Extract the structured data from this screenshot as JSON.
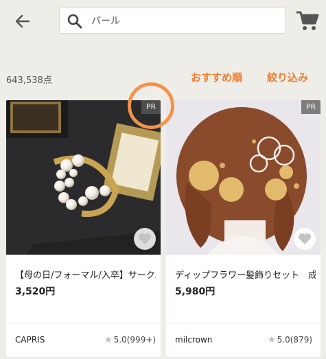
{
  "header": {
    "search_value": "パール"
  },
  "toolbar": {
    "count": "643,538点",
    "sort_label": "おすすめ順",
    "filter_label": "絞り込み"
  },
  "products": [
    {
      "badge": "PR",
      "title": "【母の日/フォーマル/入卒】サークル",
      "price": "3,520円",
      "shop": "CAPRIS",
      "rating": "5.0(999+)"
    },
    {
      "badge": "PR",
      "title": "ディップフラワー髪飾りセット　成人",
      "price": "5,980円",
      "shop": "milcrown",
      "rating": "5.0(879)"
    }
  ],
  "icons": {
    "back": "arrow-left-icon",
    "search": "search-icon",
    "cart": "cart-icon",
    "favorite": "heart-icon",
    "star": "star-icon"
  },
  "colors": {
    "accent": "#ef7d2f",
    "background": "#efede8"
  }
}
